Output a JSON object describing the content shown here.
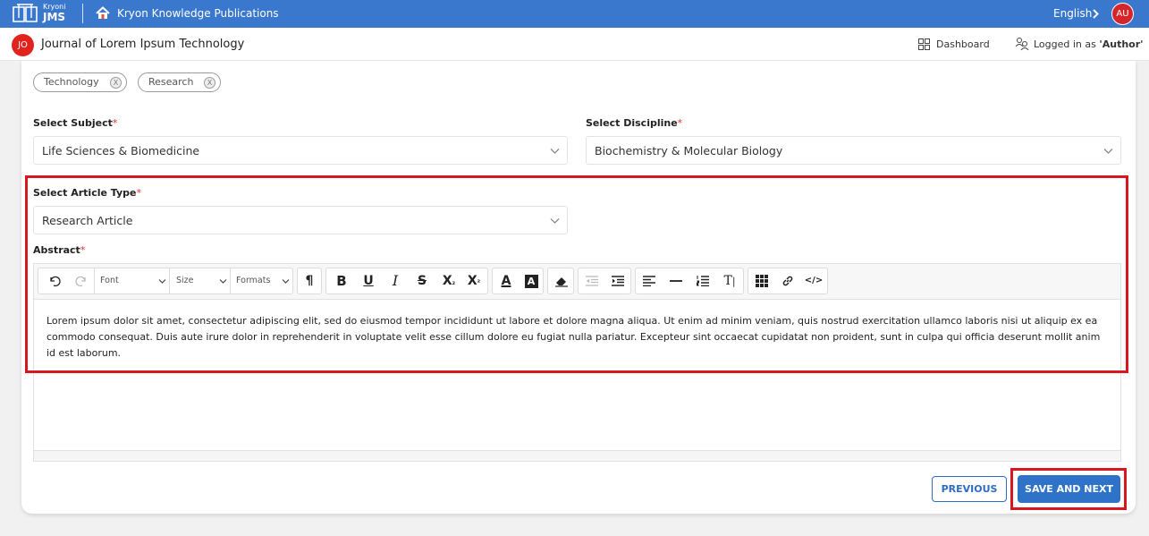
{
  "topbar": {
    "logo_small": "Kryoni",
    "logo_big": "JMS",
    "publisher": "Kryon Knowledge Publications",
    "language": "English",
    "user_initials": "AU"
  },
  "subheader": {
    "journal_initials": "JO",
    "journal_title": "Journal of Lorem Ipsum Technology",
    "dashboard_label": "Dashboard",
    "logged_in_prefix": "Logged in as ",
    "logged_in_role": "'Author'"
  },
  "keywords": [
    {
      "label": "Technology",
      "remove": "X"
    },
    {
      "label": "Research",
      "remove": "X"
    }
  ],
  "form": {
    "subject": {
      "label": "Select Subject",
      "required": "*",
      "value": "Life Sciences & Biomedicine"
    },
    "discipline": {
      "label": "Select Discipline",
      "required": "*",
      "value": "Biochemistry & Molecular Biology"
    },
    "article_type": {
      "label": "Select Article Type",
      "required": "*",
      "value": "Research Article"
    },
    "abstract": {
      "label": "Abstract",
      "required": "*",
      "text": "Lorem ipsum dolor sit amet, consectetur adipiscing elit, sed do eiusmod tempor incididunt ut labore et dolore magna aliqua. Ut enim ad minim veniam, quis nostrud exercitation ullamco laboris nisi ut aliquip ex ea commodo consequat. Duis aute irure dolor in reprehenderit in voluptate velit esse cillum dolore eu fugiat nulla pariatur. Excepteur sint occaecat cupidatat non proident, sunt in culpa qui officia deserunt mollit anim id est laborum."
    }
  },
  "toolbar": {
    "font_label": "Font",
    "size_label": "Size",
    "formats_label": "Formats",
    "paragraph": "¶",
    "bold": "B",
    "underline": "U",
    "italic": "I",
    "strike": "S",
    "subscript": "X",
    "subscript_mark": "₂",
    "superscript": "X",
    "superscript_mark": "²",
    "font_color": "A",
    "highlight": "A",
    "text_size": "T",
    "source": "</>"
  },
  "actions": {
    "previous": "PREVIOUS",
    "save_next": "SAVE AND NEXT"
  },
  "colors": {
    "topbar": "#3a78cd",
    "primary_button": "#2e73c8",
    "highlight_outline": "#d8161e",
    "avatar": "#d6252a"
  }
}
